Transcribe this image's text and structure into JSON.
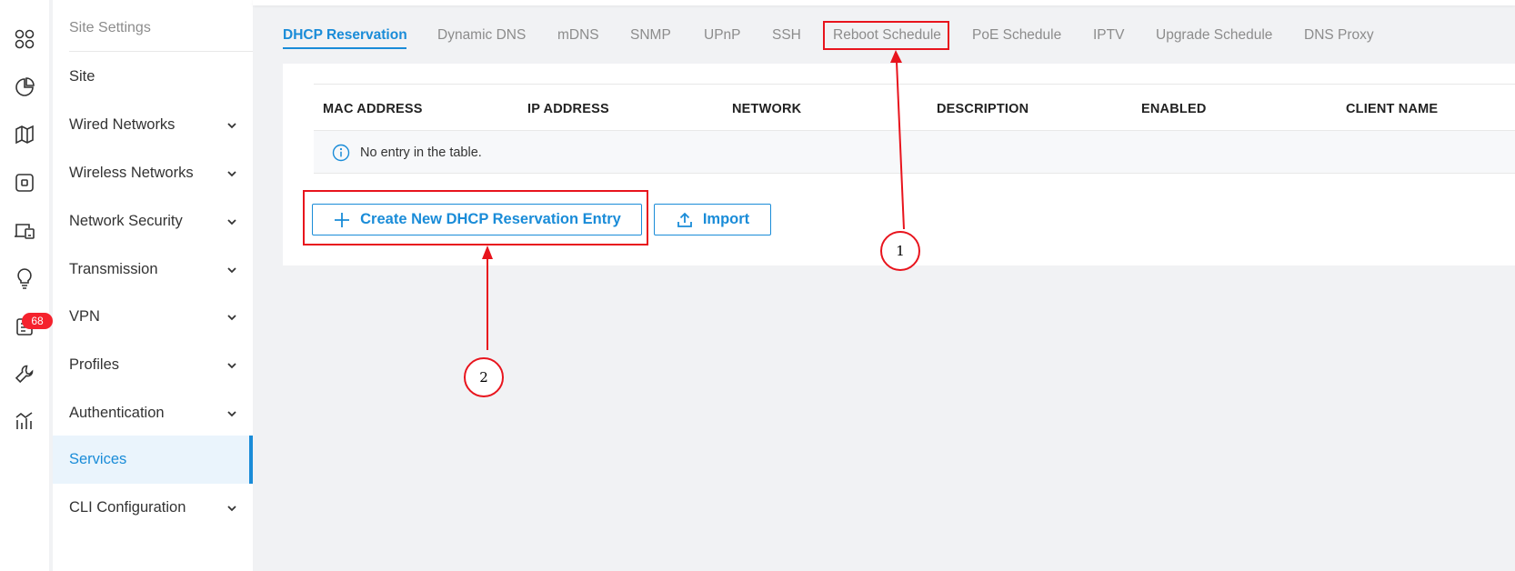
{
  "rail": {
    "icons": [
      "dashboard-icon",
      "statistics-icon",
      "map-icon",
      "devices-icon",
      "clients-icon",
      "insights-icon",
      "logs-icon",
      "tools-icon",
      "reports-icon"
    ],
    "logs_badge": "68"
  },
  "sidebar": {
    "title": "Site Settings",
    "items": [
      {
        "label": "Site"
      },
      {
        "label": "Wired Networks"
      },
      {
        "label": "Wireless Networks"
      },
      {
        "label": "Network Security"
      },
      {
        "label": "Transmission"
      },
      {
        "label": "VPN"
      },
      {
        "label": "Profiles"
      },
      {
        "label": "Authentication"
      },
      {
        "label": "Services"
      },
      {
        "label": "CLI Configuration"
      }
    ]
  },
  "tabs": [
    {
      "label": "DHCP Reservation"
    },
    {
      "label": "Dynamic DNS"
    },
    {
      "label": "mDNS"
    },
    {
      "label": "SNMP"
    },
    {
      "label": "UPnP"
    },
    {
      "label": "SSH"
    },
    {
      "label": "Reboot Schedule"
    },
    {
      "label": "PoE Schedule"
    },
    {
      "label": "IPTV"
    },
    {
      "label": "Upgrade Schedule"
    },
    {
      "label": "DNS Proxy"
    }
  ],
  "table": {
    "columns": [
      "MAC ADDRESS",
      "IP ADDRESS",
      "NETWORK",
      "DESCRIPTION",
      "ENABLED",
      "CLIENT NAME"
    ],
    "empty_text": "No entry in the table."
  },
  "actions": {
    "create_label": "Create New DHCP Reservation Entry",
    "import_label": "Import"
  },
  "annotations": {
    "callout_1": "1",
    "callout_2": "2"
  },
  "colors": {
    "accent": "#1a8cd8",
    "annotation": "#e8141d",
    "badge": "#f5222d"
  }
}
